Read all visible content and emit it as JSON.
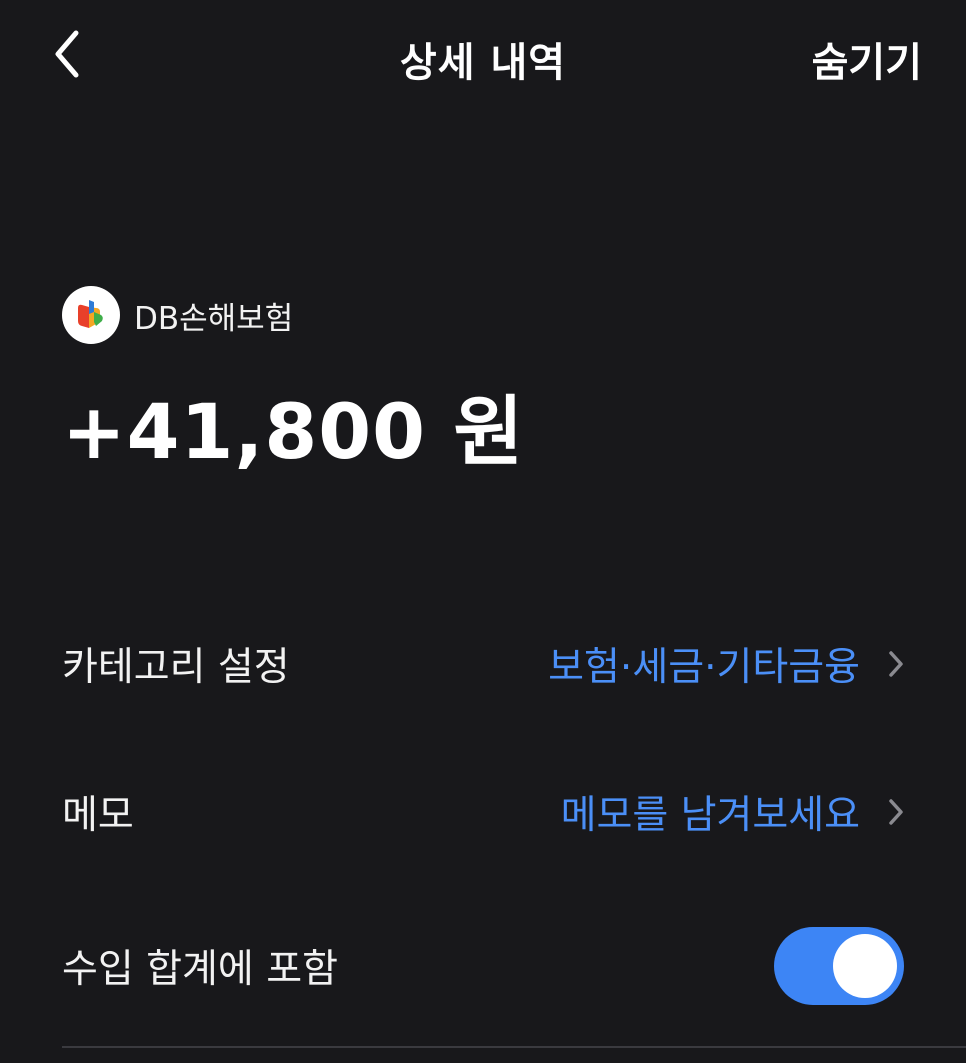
{
  "header": {
    "title": "상세 내역",
    "hide_label": "숨기기",
    "back_icon": "chevron-left-icon"
  },
  "transaction": {
    "merchant_name": "DB손해보험",
    "merchant_logo_icon": "db-insurance-logo",
    "amount": "+41,800 원"
  },
  "rows": {
    "category": {
      "label": "카테고리 설정",
      "value": "보험·세금·기타금융"
    },
    "memo": {
      "label": "메모",
      "value": "메모를 남겨보세요"
    },
    "include_income": {
      "label": "수입 합계에 포함",
      "enabled": true
    }
  },
  "colors": {
    "background": "#18181b",
    "accent_blue": "#4b8ff7",
    "toggle_on": "#3d85f5",
    "text_primary": "#ffffff"
  }
}
